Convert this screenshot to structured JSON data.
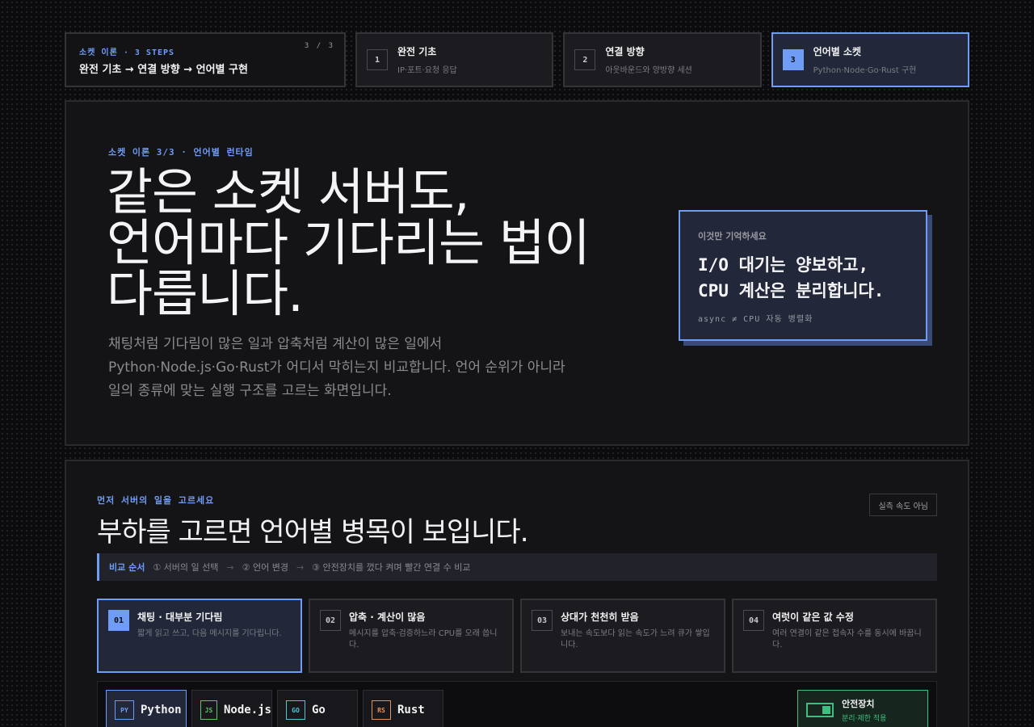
{
  "steps": {
    "eyebrow": "소켓 이론 · 3 STEPS",
    "counter": "3 / 3",
    "path": "완전 기초 → 연결 방향 → 언어별 구현",
    "items": [
      {
        "num": "1",
        "title": "완전 기초",
        "sub": "IP·포트·요청 응답"
      },
      {
        "num": "2",
        "title": "연결 방향",
        "sub": "아웃바운드와 양방향 세션"
      },
      {
        "num": "3",
        "title": "언어별 소켓",
        "sub": "Python·Node·Go·Rust 구현"
      }
    ]
  },
  "hero": {
    "eyebrow": "소켓 이론 3/3 · 언어별 런타임",
    "title_line1": "같은 소켓 서버도,",
    "title_line2": "언어마다 기다리는 법이",
    "title_line3": "다릅니다.",
    "desc_line1": "채팅처럼 기다림이 많은 일과 압축처럼 계산이 많은 일에서",
    "desc_line2": "Python·Node.js·Go·Rust가 어디서 막히는지 비교합니다. 언어 순위가 아니라",
    "desc_line3": "일의 종류에 맞는 실행 구조를 고르는 화면입니다.",
    "memo": {
      "label": "이것만 기억하세요",
      "line1": "I/O 대기는 양보하고,",
      "line2": "CPU 계산은 분리합니다.",
      "foot": "async ≠ CPU 자동 병렬화"
    }
  },
  "section2": {
    "eyebrow": "먼저 서버의 일을 고르세요",
    "title": "부하를 고르면 언어별 병목이 보입니다.",
    "badge": "실측 속도 아님",
    "order": {
      "label": "비교 순서",
      "step1": "① 서버의 일 선택",
      "arrow": "→",
      "step2": "② 언어 변경",
      "step3": "③ 안전장치를 껐다 켜며 빨간 연결 수 비교"
    },
    "loads": [
      {
        "num": "01",
        "title": "채팅 · 대부분 기다림",
        "desc": "짧게 읽고 쓰고, 다음 메시지를 기다립니다."
      },
      {
        "num": "02",
        "title": "압축 · 계산이 많음",
        "desc": "메시지를 압축·검증하느라 CPU를 오래 씁니다."
      },
      {
        "num": "03",
        "title": "상대가 천천히 받음",
        "desc": "보내는 속도보다 읽는 속도가 느려 큐가 쌓입니다."
      },
      {
        "num": "04",
        "title": "여럿이 같은 값 수정",
        "desc": "여러 연결이 같은 접속자 수를 동시에 바꿉니다."
      }
    ],
    "langs": [
      {
        "code": "PY",
        "name": "Python",
        "color": "#6f9cf5"
      },
      {
        "code": "JS",
        "name": "Node.js",
        "color": "#5fc46a"
      },
      {
        "code": "GO",
        "name": "Go",
        "color": "#4fc6d8"
      },
      {
        "code": "RS",
        "name": "Rust",
        "color": "#e8925a"
      }
    ],
    "safety": {
      "title": "안전장치",
      "sub": "분리·제한 적용"
    }
  }
}
